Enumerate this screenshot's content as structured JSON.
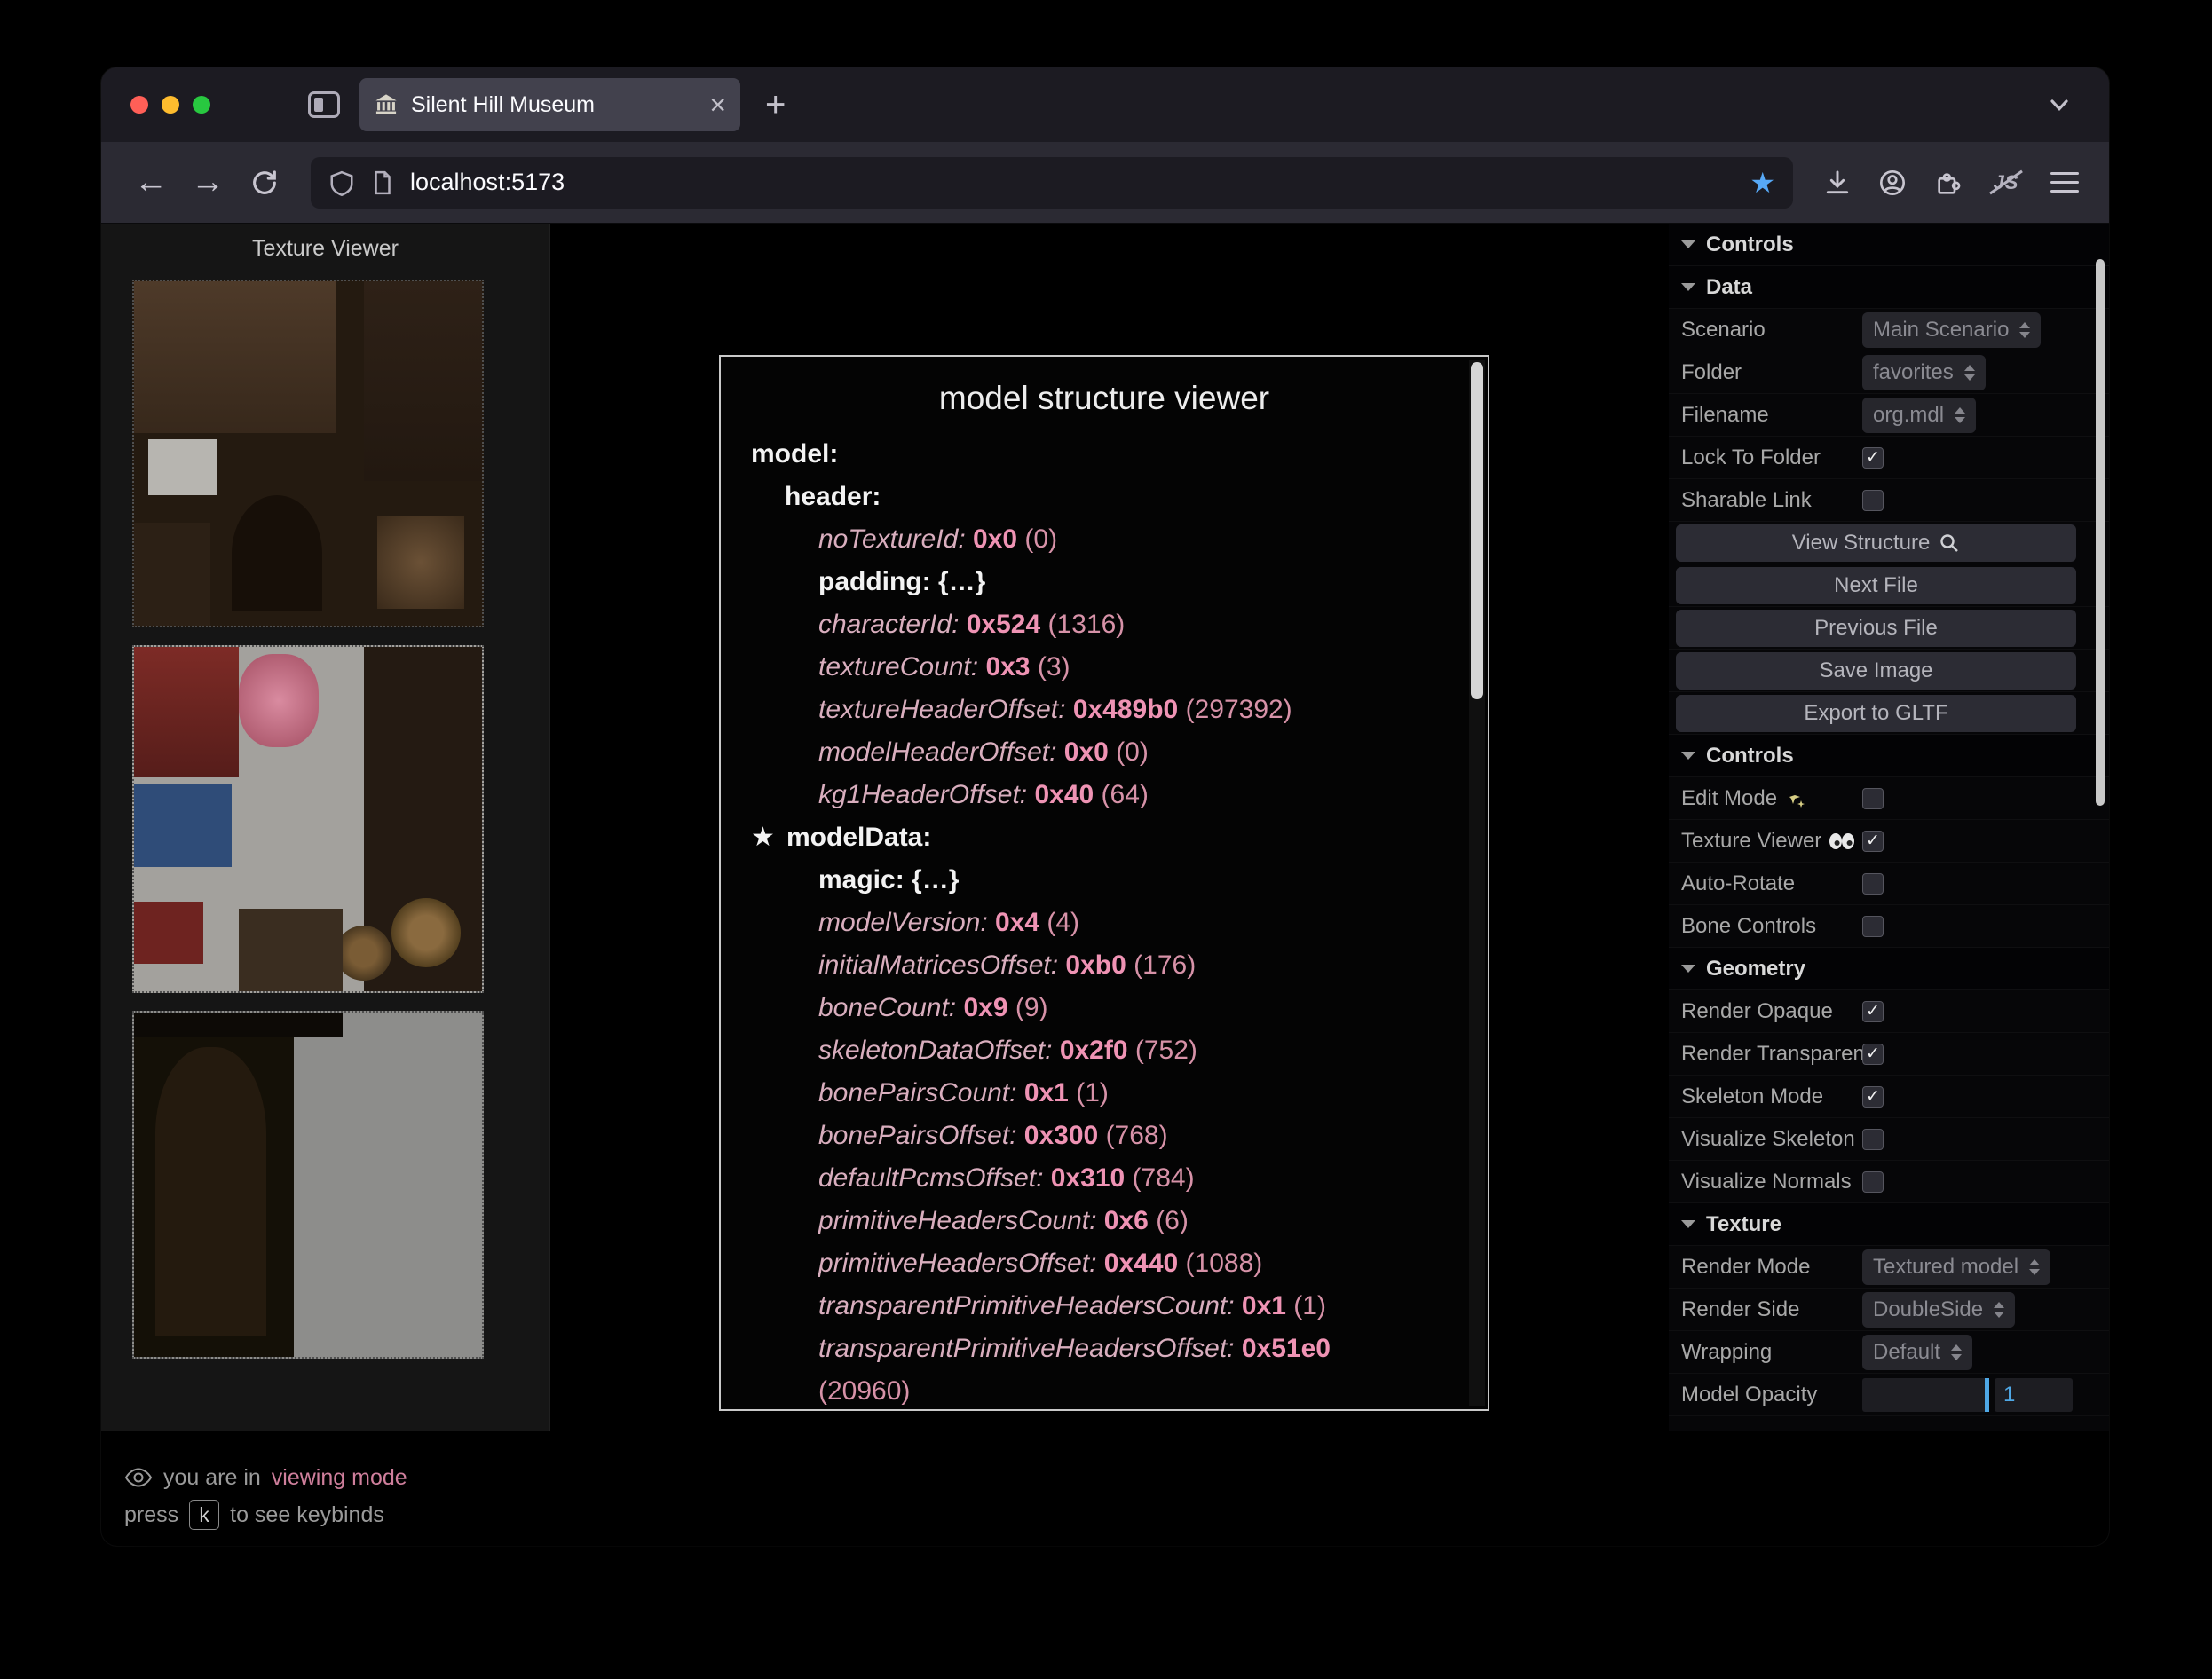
{
  "browser": {
    "tab": {
      "title": "Silent Hill Museum"
    },
    "url": "localhost:5173",
    "new_tab_label": "+",
    "tab_close_label": "×"
  },
  "texture_viewer": {
    "title": "Texture Viewer",
    "textures": [
      "texture-atlas-1",
      "texture-atlas-2",
      "texture-atlas-3"
    ]
  },
  "status_bar": {
    "mode_prefix": "you are in",
    "mode": "viewing mode",
    "keybind_prefix": "press",
    "key": "k",
    "keybind_suffix": "to see keybinds"
  },
  "structure_viewer": {
    "title": "model structure viewer",
    "tree": [
      {
        "indent": 0,
        "label": "model:",
        "bold": true
      },
      {
        "indent": 1,
        "label": "header:",
        "bold": true
      },
      {
        "indent": 2,
        "key": "noTextureId",
        "hex": "0x0",
        "dec": "(0)"
      },
      {
        "indent": 2,
        "label": "padding: {…}",
        "bold": true
      },
      {
        "indent": 2,
        "key": "characterId",
        "hex": "0x524",
        "dec": "(1316)"
      },
      {
        "indent": 2,
        "key": "textureCount",
        "hex": "0x3",
        "dec": "(3)"
      },
      {
        "indent": 2,
        "key": "textureHeaderOffset",
        "hex": "0x489b0",
        "dec": "(297392)"
      },
      {
        "indent": 2,
        "key": "modelHeaderOffset",
        "hex": "0x0",
        "dec": "(0)"
      },
      {
        "indent": 2,
        "key": "kg1HeaderOffset",
        "hex": "0x40",
        "dec": "(64)"
      },
      {
        "indent": 1,
        "label": "modelData:",
        "bold": true,
        "star": true
      },
      {
        "indent": 2,
        "label": "magic: {…}",
        "bold": true
      },
      {
        "indent": 2,
        "key": "modelVersion",
        "hex": "0x4",
        "dec": "(4)"
      },
      {
        "indent": 2,
        "key": "initialMatricesOffset",
        "hex": "0xb0",
        "dec": "(176)"
      },
      {
        "indent": 2,
        "key": "boneCount",
        "hex": "0x9",
        "dec": "(9)"
      },
      {
        "indent": 2,
        "key": "skeletonDataOffset",
        "hex": "0x2f0",
        "dec": "(752)"
      },
      {
        "indent": 2,
        "key": "bonePairsCount",
        "hex": "0x1",
        "dec": "(1)"
      },
      {
        "indent": 2,
        "key": "bonePairsOffset",
        "hex": "0x300",
        "dec": "(768)"
      },
      {
        "indent": 2,
        "key": "defaultPcmsOffset",
        "hex": "0x310",
        "dec": "(784)"
      },
      {
        "indent": 2,
        "key": "primitiveHeadersCount",
        "hex": "0x6",
        "dec": "(6)"
      },
      {
        "indent": 2,
        "key": "primitiveHeadersOffset",
        "hex": "0x440",
        "dec": "(1088)"
      },
      {
        "indent": 2,
        "key": "transparentPrimitiveHeadersCount",
        "hex": "0x1",
        "dec": "(1)"
      },
      {
        "indent": 2,
        "key": "transparentPrimitiveHeadersOffset",
        "hex": "0x51e0",
        "dec": "(20960)",
        "wrap": true
      }
    ]
  },
  "controls_panel": {
    "root": "Controls",
    "folders": [
      {
        "label": "Data",
        "rows": [
          {
            "type": "select",
            "label": "Scenario",
            "value": "Main Scenario"
          },
          {
            "type": "select",
            "label": "Folder",
            "value": "favorites"
          },
          {
            "type": "select",
            "label": "Filename",
            "value": "org.mdl"
          },
          {
            "type": "checkbox",
            "label": "Lock To Folder",
            "checked": true
          },
          {
            "type": "checkbox",
            "label": "Sharable Link",
            "checked": false
          },
          {
            "type": "button",
            "label": "View Structure",
            "icon": "magnifier-icon"
          },
          {
            "type": "button",
            "label": "Next File"
          },
          {
            "type": "button",
            "label": "Previous File"
          },
          {
            "type": "button",
            "label": "Save Image"
          },
          {
            "type": "button",
            "label": "Export to GLTF"
          }
        ]
      },
      {
        "label": "Controls",
        "rows": [
          {
            "type": "checkbox",
            "label": "Edit Mode",
            "icon": "sparkles-icon",
            "checked": false
          },
          {
            "type": "checkbox",
            "label": "Texture Viewer",
            "icon": "eyes-icon",
            "checked": true
          },
          {
            "type": "checkbox",
            "label": "Auto-Rotate",
            "checked": false
          },
          {
            "type": "checkbox",
            "label": "Bone Controls",
            "checked": false
          }
        ]
      },
      {
        "label": "Geometry",
        "rows": [
          {
            "type": "checkbox",
            "label": "Render Opaque",
            "checked": true
          },
          {
            "type": "checkbox",
            "label": "Render Transparent",
            "checked": true
          },
          {
            "type": "checkbox",
            "label": "Skeleton Mode",
            "checked": true
          },
          {
            "type": "checkbox",
            "label": "Visualize Skeleton",
            "checked": false
          },
          {
            "type": "checkbox",
            "label": "Visualize Normals",
            "checked": false
          }
        ]
      },
      {
        "label": "Texture",
        "rows": [
          {
            "type": "select",
            "label": "Render Mode",
            "value": "Textured model"
          },
          {
            "type": "select",
            "label": "Render Side",
            "value": "DoubleSide"
          },
          {
            "type": "select",
            "label": "Wrapping",
            "value": "Default"
          },
          {
            "type": "slider",
            "label": "Model Opacity",
            "value": "1"
          }
        ]
      }
    ]
  },
  "colors": {
    "accent_pink": "#ef93b4",
    "accent_blue": "#4fa8e6",
    "bookmark_star_blue": "#57a9f7",
    "traffic_red": "#ff5f57",
    "traffic_yellow": "#febc2e",
    "traffic_green": "#28c840"
  }
}
